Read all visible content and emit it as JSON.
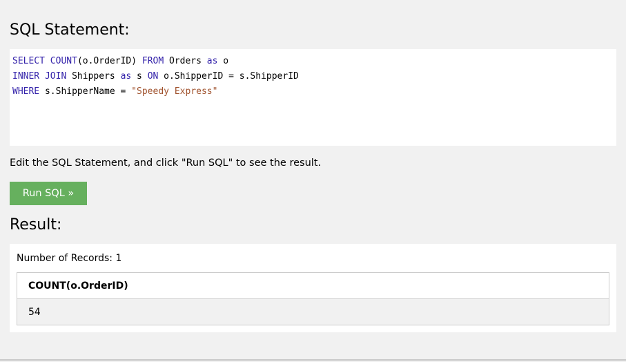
{
  "sql_section": {
    "title": "SQL Statement:",
    "lines": [
      [
        {
          "t": "SELECT",
          "k": "kw"
        },
        {
          "t": " ",
          "k": ""
        },
        {
          "t": "COUNT",
          "k": "kw"
        },
        {
          "t": "(o.OrderID) ",
          "k": ""
        },
        {
          "t": "FROM",
          "k": "kw"
        },
        {
          "t": " Orders ",
          "k": ""
        },
        {
          "t": "as",
          "k": "kw"
        },
        {
          "t": " o",
          "k": ""
        }
      ],
      [
        {
          "t": "INNER",
          "k": "kw"
        },
        {
          "t": " ",
          "k": ""
        },
        {
          "t": "JOIN",
          "k": "kw"
        },
        {
          "t": " Shippers ",
          "k": ""
        },
        {
          "t": "as",
          "k": "kw"
        },
        {
          "t": " s ",
          "k": ""
        },
        {
          "t": "ON",
          "k": "kw"
        },
        {
          "t": " o.ShipperID = s.ShipperID",
          "k": ""
        }
      ],
      [
        {
          "t": "WHERE",
          "k": "kw"
        },
        {
          "t": " s.ShipperName = ",
          "k": ""
        },
        {
          "t": "\"Speedy Express\"",
          "k": "str"
        }
      ]
    ]
  },
  "hint_text": "Edit the SQL Statement, and click \"Run SQL\" to see the result.",
  "run_button_label": "Run SQL »",
  "result_section": {
    "title": "Result:",
    "record_count_text": "Number of Records: 1",
    "columns": [
      "COUNT(o.OrderID)"
    ],
    "rows": [
      [
        "54"
      ]
    ]
  },
  "colors": {
    "background": "#f1f1f1",
    "button": "#66b05e",
    "keyword": "#3322aa",
    "string": "#a0522d"
  }
}
